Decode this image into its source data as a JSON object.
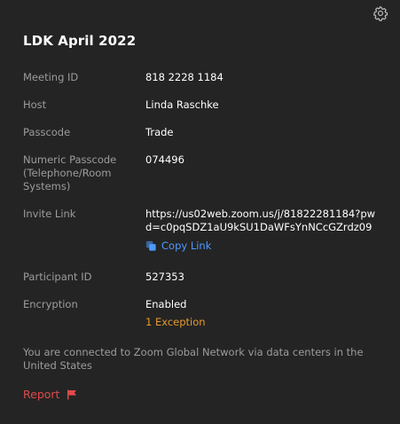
{
  "meeting": {
    "title": "LDK April 2022"
  },
  "fields": {
    "meeting_id": {
      "label": "Meeting ID",
      "value": "818 2228 1184"
    },
    "host": {
      "label": "Host",
      "value": "Linda Raschke"
    },
    "passcode": {
      "label": "Passcode",
      "value": "Trade"
    },
    "numeric_passcode": {
      "label": "Numeric Passcode (Telephone/Room Systems)",
      "value": "074496"
    },
    "invite_link": {
      "label": "Invite Link",
      "value": "https://us02web.zoom.us/j/81822281184?pwd=c0pqSDZ1aU9kSU1DaWFsYnNCcGZrdz09",
      "copy_label": "Copy Link"
    },
    "participant_id": {
      "label": "Participant ID",
      "value": "527353"
    },
    "encryption": {
      "label": "Encryption",
      "value": "Enabled",
      "exception_label": "1 Exception"
    }
  },
  "network_note": "You are connected to Zoom Global Network via data centers in the United States",
  "report_label": "Report",
  "icons": {
    "settings": "gear-icon",
    "copy": "copy-icon",
    "report": "flag-icon"
  },
  "colors": {
    "background": "#242424",
    "label": "#9c9c9c",
    "link": "#4c9aff",
    "warning": "#e69a2e",
    "danger": "#e04a4a"
  }
}
